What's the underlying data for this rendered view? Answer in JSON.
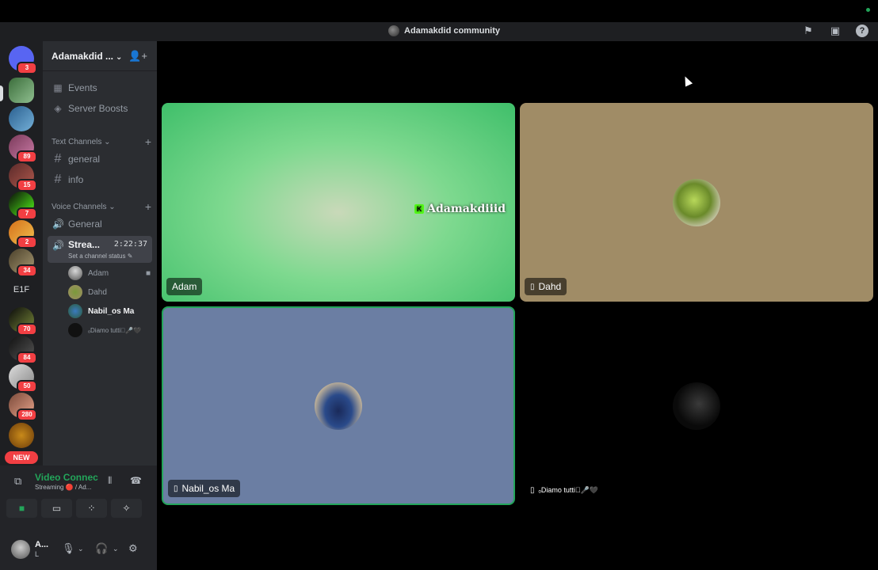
{
  "window": {
    "title": "Adamakdid community"
  },
  "rail": {
    "badges": [
      "3",
      "89",
      "15",
      "7",
      "2",
      "34",
      "70",
      "84",
      "50",
      "280"
    ],
    "text_server": "E1F",
    "new_label": "NEW"
  },
  "guild": {
    "name": "Adamakdid ..."
  },
  "menu": {
    "events": "Events",
    "boosts": "Server Boosts"
  },
  "text_channels": {
    "header": "Text Channels",
    "items": [
      "general",
      "info"
    ]
  },
  "voice_channels": {
    "header": "Voice Channels",
    "general": "General",
    "stream": {
      "name": "Strea...",
      "time": "2:22:37",
      "status": "Set a channel status"
    },
    "members": [
      "Adam",
      "Dahd",
      "Nabil_os Ma",
      "ₒDiamo tutti🏻‍🎤🖤"
    ]
  },
  "voice_panel": {
    "status": "Video Connected",
    "sub": "Streaming 🔴 / Ad..."
  },
  "user": {
    "name": "A...",
    "sub": "L"
  },
  "tiles": [
    {
      "label": "Adam",
      "bg": "#6be08a",
      "overlay": "Adamakdiiid"
    },
    {
      "label": "Dahd",
      "bg": "#a08c66"
    },
    {
      "label": "Nabil_os Ma",
      "bg": "#6b7ea3"
    },
    {
      "label": "ₒDiamo tutti🏻‍🎤🖤",
      "bg": "#000000"
    }
  ]
}
